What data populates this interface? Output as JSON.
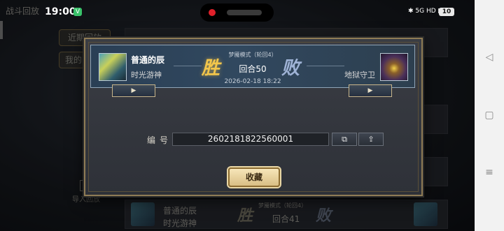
{
  "status": {
    "time": "19:00",
    "app_badge": "V",
    "network_text": "5G HD",
    "battery": "10"
  },
  "background": {
    "title": "战斗回放",
    "tabs": [
      "近期回放",
      "我的"
    ],
    "import_label": "导入回放",
    "row": {
      "player": "普通的辰",
      "hero": "时光游神",
      "result": "胜",
      "loss": "败",
      "mode": "梦魇模式（轮回4）",
      "round": "回合41"
    }
  },
  "replay": {
    "player_name": "普通的辰",
    "player_hero": "时光游神",
    "win_text": "胜",
    "lose_text": "败",
    "mode": "梦魇模式（轮回4）",
    "round": "回合50",
    "datetime": "2026-02-18 18:22",
    "opponent_hero": "地狱守卫",
    "play_left_icon": "▶",
    "play_right_icon": "▶"
  },
  "id_section": {
    "label": "编号",
    "value": "2602181822560001",
    "copy_icon": "copy-icon",
    "share_icon": "share-icon"
  },
  "actions": {
    "collect_label": "收藏"
  },
  "navbar": {
    "back_icon": "◁",
    "home_icon": "▢",
    "menu_icon": "≡"
  }
}
